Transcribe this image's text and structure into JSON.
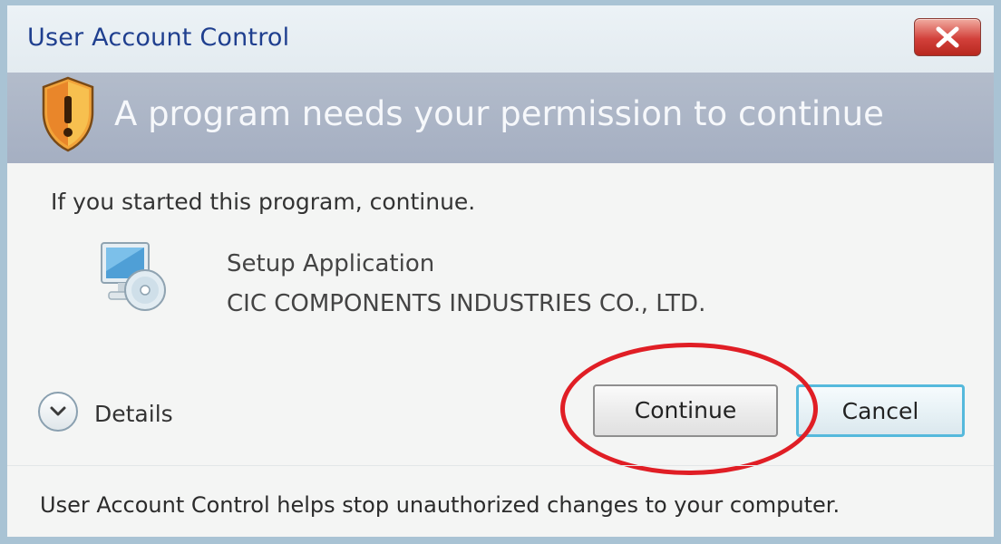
{
  "window": {
    "title": "User Account Control"
  },
  "banner": {
    "heading": "A program needs your permission to continue"
  },
  "body": {
    "prompt": "If you started this program, continue.",
    "program_name": "Setup Application",
    "publisher": "CIC COMPONENTS INDUSTRIES CO., LTD."
  },
  "details": {
    "label": "Details"
  },
  "buttons": {
    "continue_label": "Continue",
    "cancel_label": "Cancel"
  },
  "footer": {
    "text": "User Account Control helps stop unauthorized changes to your computer."
  },
  "icons": {
    "close": "close-icon",
    "shield": "shield-warning-icon",
    "program": "computer-disc-icon",
    "details": "chevron-down-icon"
  },
  "colors": {
    "title_text": "#1f3f8f",
    "banner": "#a9b2c5",
    "close_button": "#d2403a",
    "cancel_focus_border": "#55b9dc",
    "highlight_circle": "#e01e25"
  }
}
